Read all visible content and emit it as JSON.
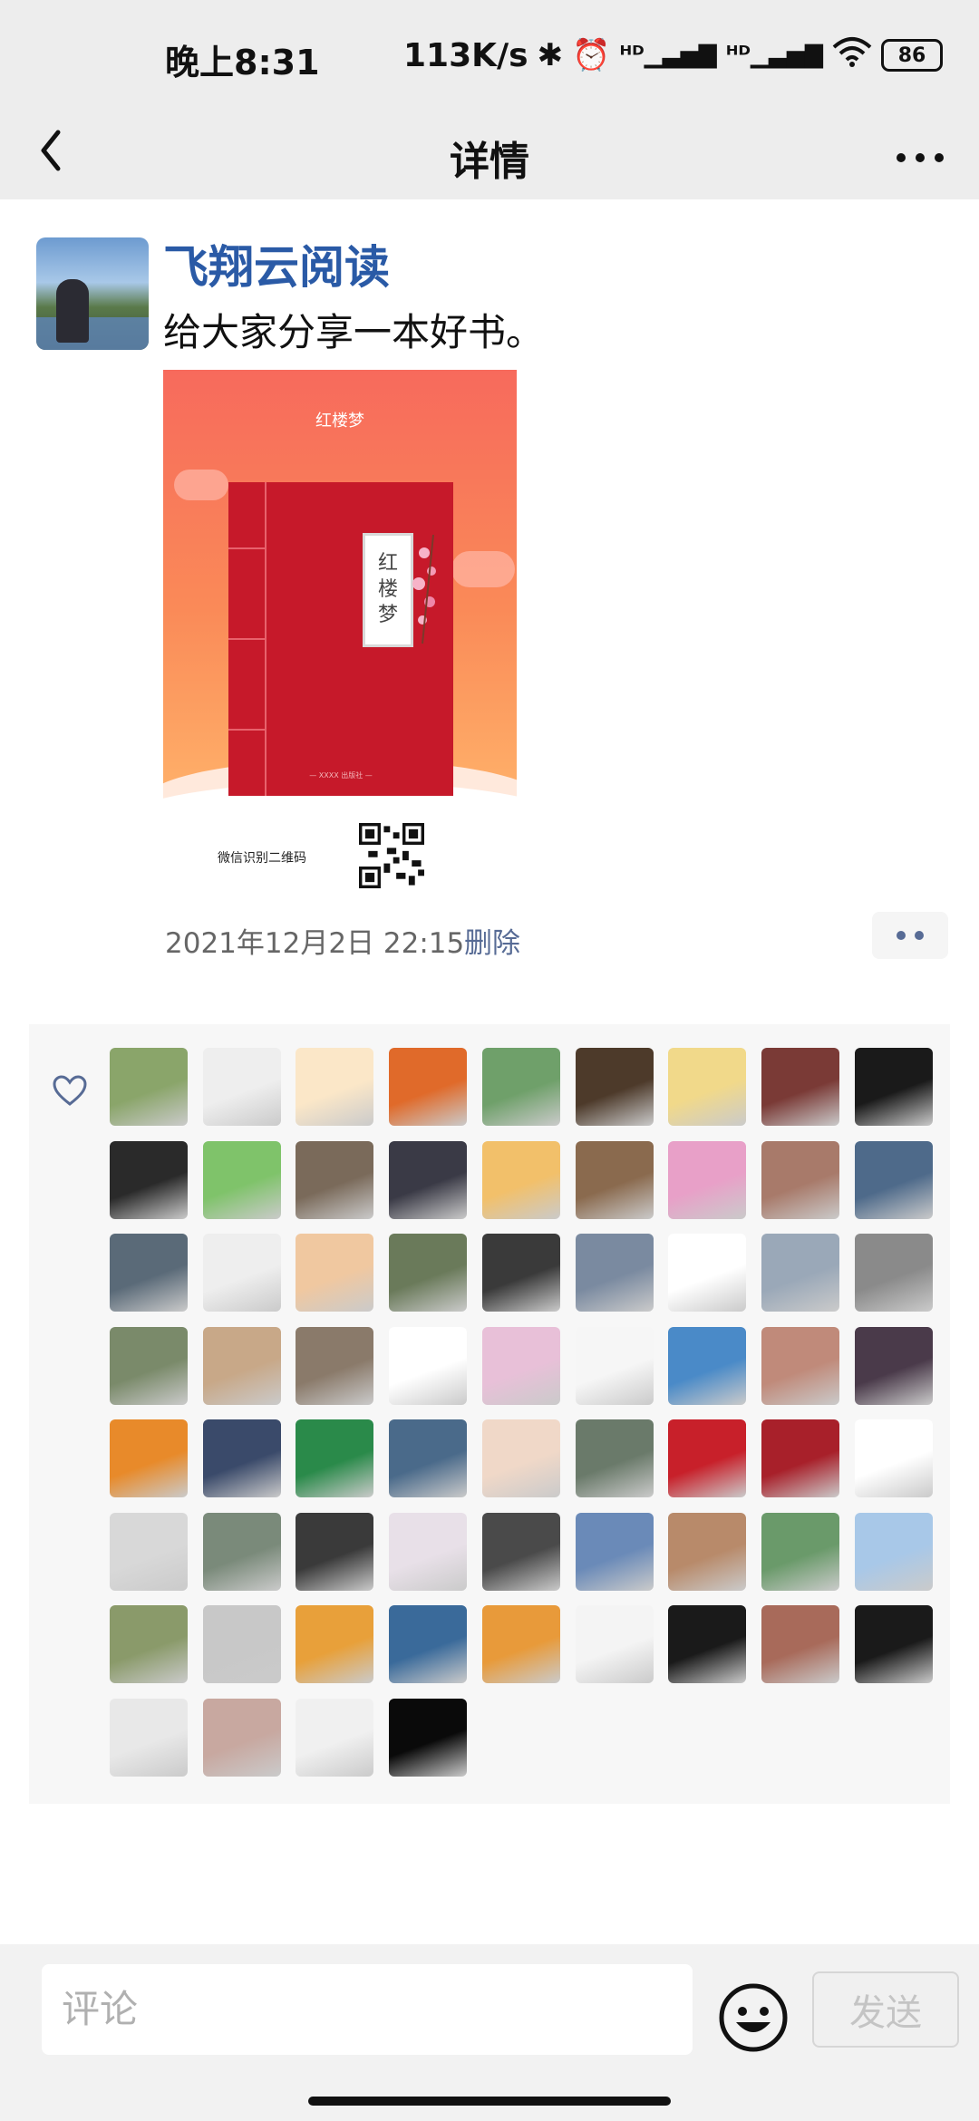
{
  "status_bar": {
    "time": "晚上8:31",
    "net_speed": "113K/s",
    "battery": "86",
    "icons": [
      "bluetooth-icon",
      "alarm-icon",
      "signal-hd-icon",
      "signal-hd-icon",
      "wifi-icon",
      "battery-icon"
    ]
  },
  "header": {
    "title": "详情"
  },
  "post": {
    "author": "飞翔云阅读",
    "text": "给大家分享一本好书。",
    "image": {
      "poster_title": "红楼梦",
      "book_label": [
        "红",
        "楼",
        "梦"
      ],
      "book_footnote": "— XXXX 出版社 —",
      "qr_caption": "微信识别二维码"
    },
    "timestamp": "2021年12月2日  22:15",
    "delete_label": "删除"
  },
  "likes": {
    "count": 67,
    "avatar_colors": [
      "#8aa56a",
      "#eeeeee",
      "#fbe7c8",
      "#e06a2a",
      "#6fa06a",
      "#4d3a2a",
      "#f1d98a",
      "#7a3a36",
      "#1a1a1a",
      "#2a2a2a",
      "#7fc36a",
      "#7a6a5a",
      "#3a3a46",
      "#f2c06a",
      "#8a6a4e",
      "#e8a0c8",
      "#a87a6a",
      "#4e6a8a",
      "#5a6a78",
      "#eeeeee",
      "#f0c8a0",
      "#6a7a5a",
      "#3a3a3a",
      "#7a8aa0",
      "#ffffff",
      "#9aa8b8",
      "#8a8a8a",
      "#7a8a6a",
      "#c8a888",
      "#8a7a6a",
      "#ffffff",
      "#e8c0d8",
      "#f6f6f6",
      "#4a8ac8",
      "#c08a7a",
      "#4a3a4a",
      "#e88a2a",
      "#3a4a6a",
      "#2a8a4a",
      "#4a6a8a",
      "#f0d8c8",
      "#6a7a6a",
      "#c8202a",
      "#a8202a",
      "#ffffff",
      "#d8d8d8",
      "#7a8a7a",
      "#3a3a3a",
      "#e8e0e8",
      "#4a4a4a",
      "#6a8ab8",
      "#b88a6a",
      "#6a9a6a",
      "#a8c8e8",
      "#8a9a6a",
      "#c8c8c8",
      "#e8a03a",
      "#3a6a9a",
      "#e89a3a",
      "#f4f4f4",
      "#1a1a1a",
      "#a86a5a",
      "#1a1a1a",
      "#e8e8e8",
      "#c8a8a0",
      "#f0f0f0",
      "#0a0a0a"
    ]
  },
  "comment_bar": {
    "placeholder": "评论",
    "send_label": "发送"
  }
}
